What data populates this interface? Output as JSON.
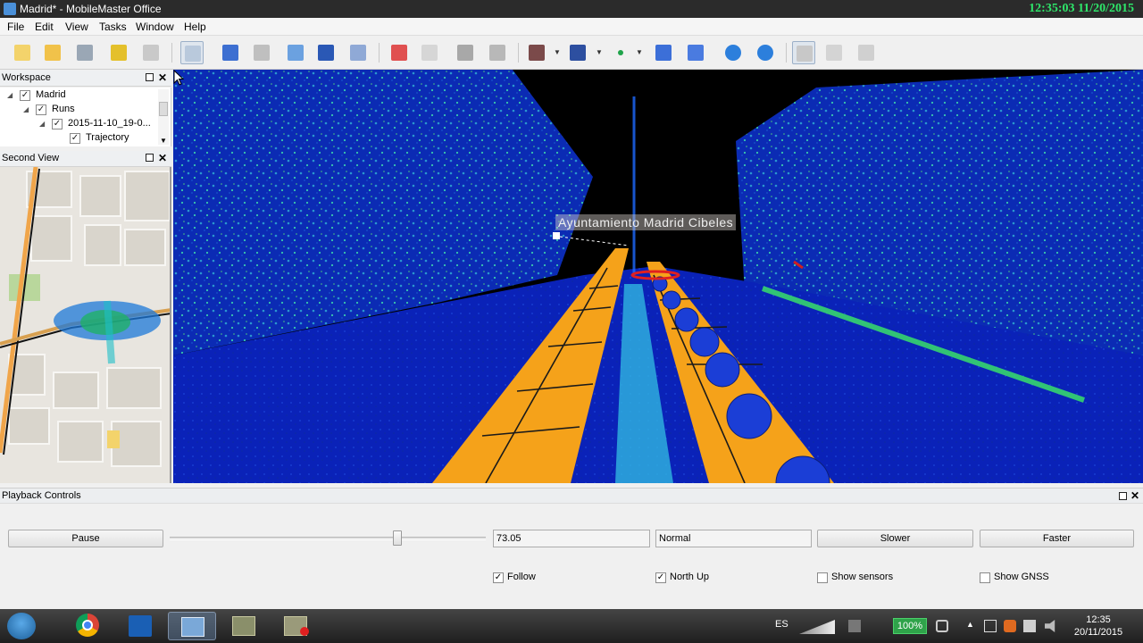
{
  "window": {
    "title": "Madrid* - MobileMaster Office",
    "clock": "12:35:03  11/20/2015"
  },
  "menu": [
    "File",
    "Edit",
    "View",
    "Tasks",
    "Window",
    "Help"
  ],
  "workspace": {
    "title": "Workspace",
    "tree": [
      {
        "label": "Madrid",
        "checked": true
      },
      {
        "label": "Runs",
        "checked": true
      },
      {
        "label": "2015-11-10_19-0...",
        "checked": true
      },
      {
        "label": "Trajectory",
        "checked": true
      }
    ]
  },
  "second_view": {
    "title": "Second View"
  },
  "viewport": {
    "poi_label": "Ayuntamiento Madrid  Cibeles"
  },
  "playback": {
    "title": "Playback Controls",
    "pause_label": "Pause",
    "position": 0.72,
    "time_value": "73.05",
    "speed_value": "Normal",
    "slower_label": "Slower",
    "faster_label": "Faster",
    "checkboxes": [
      {
        "label": "Follow",
        "checked": true
      },
      {
        "label": "North Up",
        "checked": true
      },
      {
        "label": "Show sensors",
        "checked": false
      },
      {
        "label": "Show GNSS",
        "checked": false
      }
    ]
  },
  "taskbar": {
    "language": "ES",
    "battery": "100%",
    "time": "12:35",
    "date": "20/11/2015"
  },
  "colors": {
    "clock": "#2ee66a",
    "road_lane": "#f5a21a",
    "point_cloud_blue": "#1a3fd6"
  }
}
